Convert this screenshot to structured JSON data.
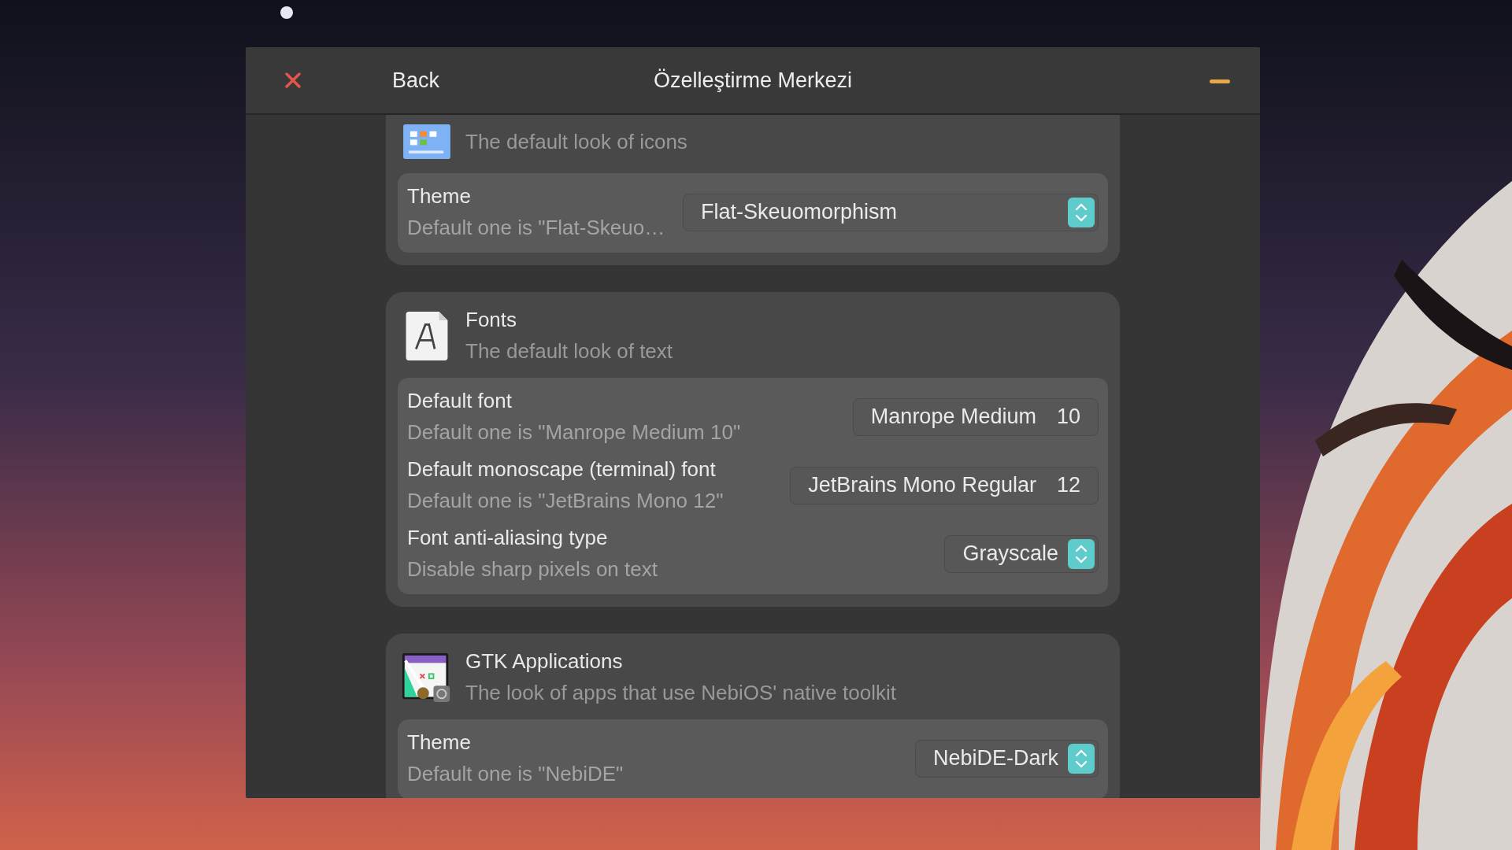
{
  "window": {
    "title": "Özelleştirme Merkezi",
    "back": "Back"
  },
  "sections": [
    {
      "kind": "icons",
      "subtitle": "The default look of icons",
      "rows": [
        {
          "kind": "dropdown",
          "label": "Theme",
          "hint": "Default one is \"Flat-Skeuo…",
          "value": "Flat-Skeuomorphism"
        }
      ]
    },
    {
      "kind": "fonts",
      "title": "Fonts",
      "subtitle": "The default look of text",
      "rows": [
        {
          "kind": "font",
          "label": "Default font",
          "hint": "Default one is \"Manrope Medium 10\"",
          "value": "Manrope Medium",
          "size": "10"
        },
        {
          "kind": "font",
          "label": "Default monoscape (terminal) font",
          "hint": "Default one is \"JetBrains Mono 12\"",
          "value": "JetBrains Mono Regular",
          "size": "12"
        },
        {
          "kind": "dropdown",
          "label": "Font anti-aliasing type",
          "hint": "Disable sharp pixels on text",
          "value": "Grayscale"
        }
      ]
    },
    {
      "kind": "gtk",
      "title": "GTK Applications",
      "subtitle": "The look of apps that use NebiOS' native toolkit",
      "rows": [
        {
          "kind": "dropdown",
          "label": "Theme",
          "hint": "Default one is \"NebiDE\"",
          "value": "NebiDE-Dark"
        }
      ]
    }
  ]
}
